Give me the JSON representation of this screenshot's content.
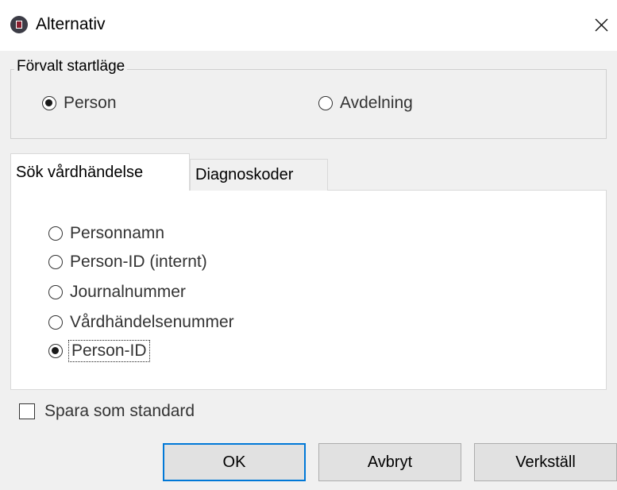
{
  "window": {
    "title": "Alternativ",
    "icon": "app-icon",
    "close_icon": "close-icon"
  },
  "startup_group": {
    "legend": "Förvalt startläge",
    "options": [
      {
        "label": "Person",
        "checked": true
      },
      {
        "label": "Avdelning",
        "checked": false
      }
    ]
  },
  "tabs": [
    {
      "label": "Sök vårdhändelse",
      "active": true
    },
    {
      "label": "Diagnoskoder",
      "active": false
    }
  ],
  "search_options": [
    {
      "label": "Personnamn",
      "checked": false
    },
    {
      "label": "Person-ID (internt)",
      "checked": false
    },
    {
      "label": "Journalnummer",
      "checked": false
    },
    {
      "label": "Vårdhändelsenummer",
      "checked": false
    },
    {
      "label": "Person-ID",
      "checked": true
    }
  ],
  "save_default": {
    "label": "Spara som standard",
    "checked": false
  },
  "buttons": {
    "ok": "OK",
    "cancel": "Avbryt",
    "apply": "Verkställ"
  },
  "colors": {
    "background": "#f0f0f0",
    "focus_border": "#0078d7"
  }
}
